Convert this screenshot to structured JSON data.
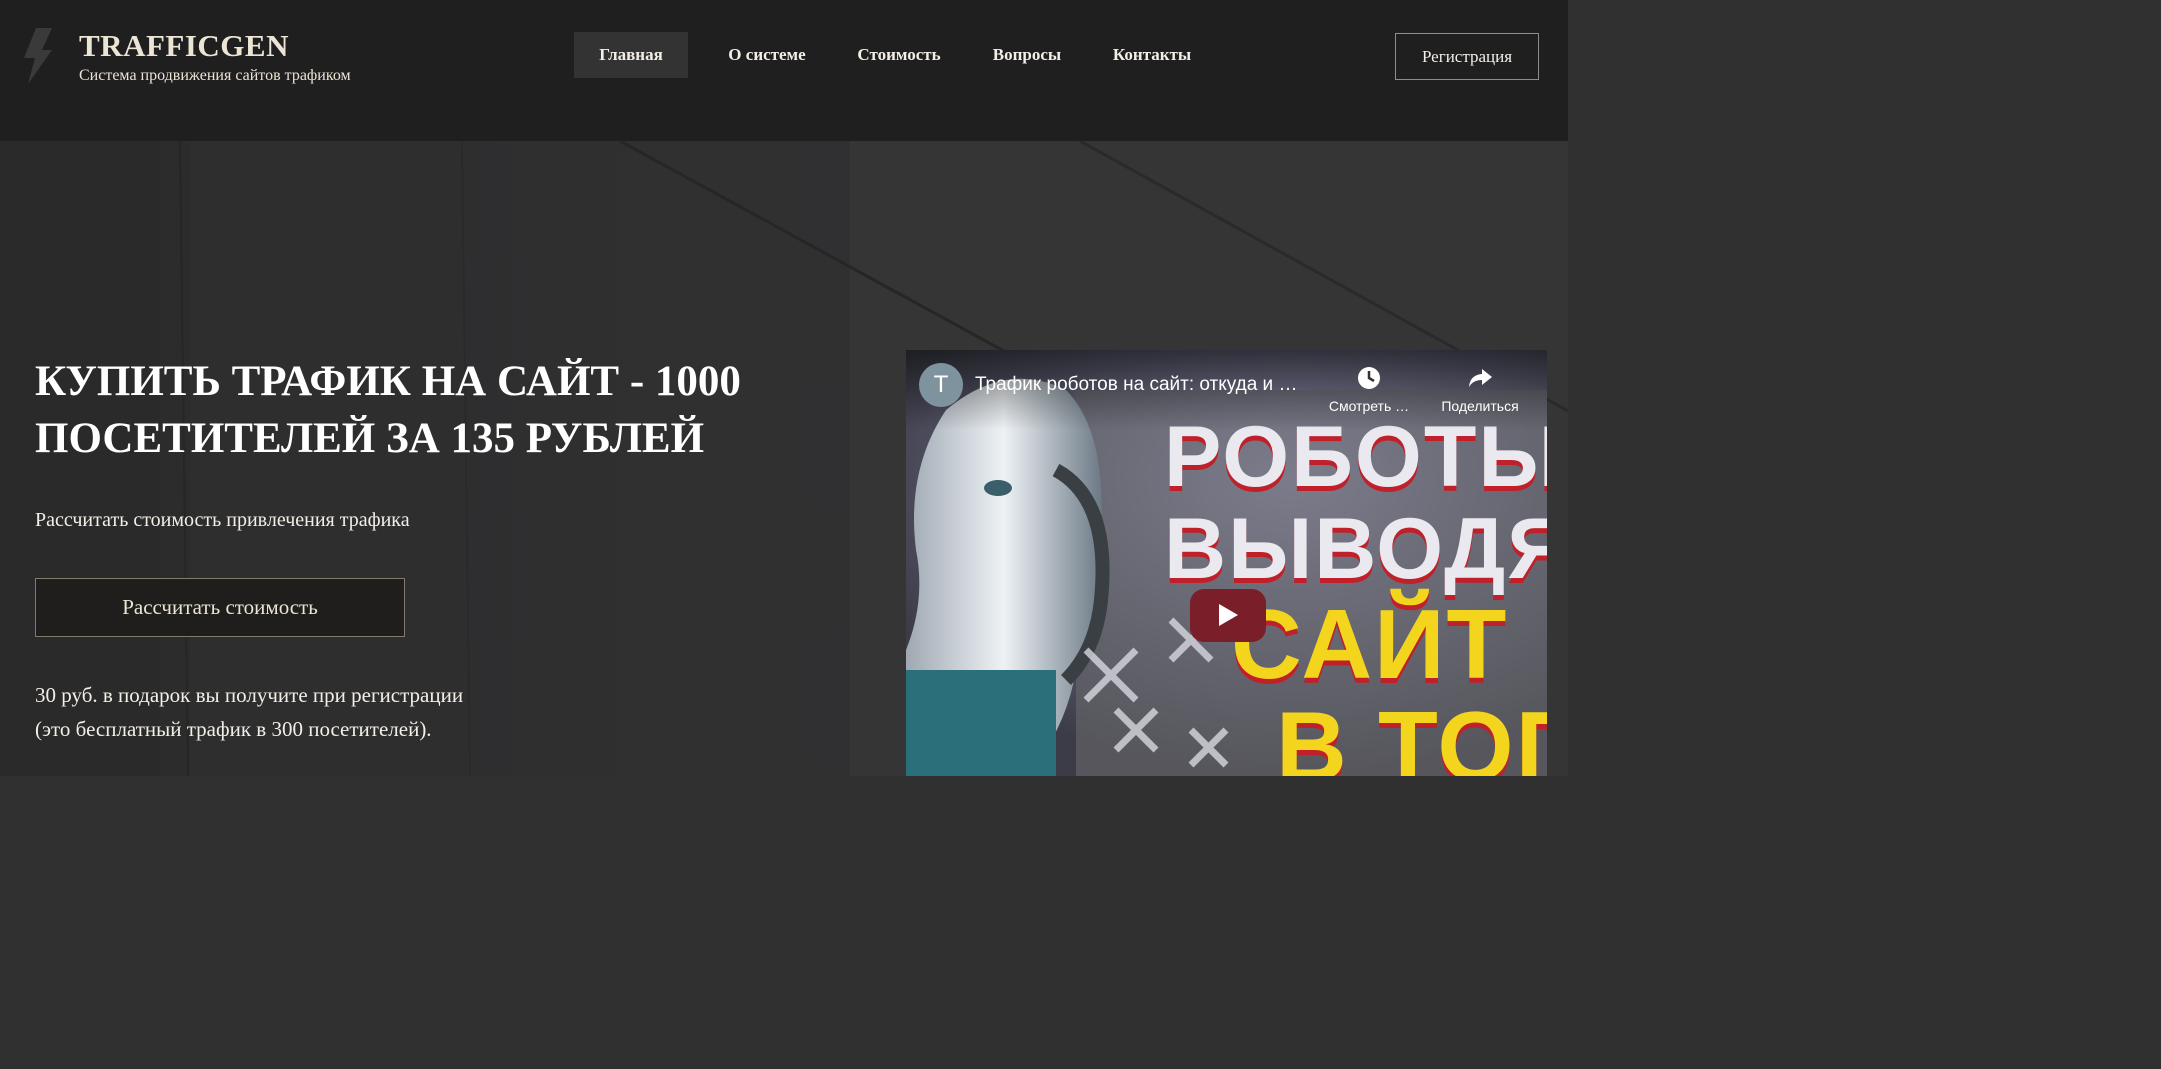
{
  "header": {
    "brand": "TRAFFICGEN",
    "tagline": "Система продвижения сайтов трафиком",
    "logo_icon": "lightning-bolt-icon",
    "nav": [
      {
        "label": "Главная",
        "active": true
      },
      {
        "label": "О системе",
        "active": false
      },
      {
        "label": "Стоимость",
        "active": false
      },
      {
        "label": "Вопросы",
        "active": false
      },
      {
        "label": "Контакты",
        "active": false
      }
    ],
    "register_label": "Регистрация"
  },
  "hero": {
    "title": "КУПИТЬ ТРАФИК НА САЙТ - 1000 ПОСЕТИТЕЛЕЙ ЗА 135 РУБЛЕЙ",
    "lead": "Рассчитать стоимость привлечения трафика",
    "button_label": "Рассчитать стоимость",
    "bonus_line1": "30 руб. в подарок вы получите при регистрации",
    "bonus_line2": "(это бесплатный трафик в 300 посетителей)."
  },
  "video": {
    "channel_initial": "T",
    "title": "Трафик роботов на сайт: откуда и …",
    "watch_later_label": "Смотреть …",
    "share_label": "Поделиться",
    "thumbnail_text": [
      "РОБОТЫ",
      "ВЫВОДЯ",
      "САЙТ",
      "В ТОП"
    ],
    "play_button_color": "#7a1f2a"
  },
  "colors": {
    "header_bg": "#1f1f1f",
    "hero_bg": "#303030",
    "accent_text": "#ece4d4"
  }
}
